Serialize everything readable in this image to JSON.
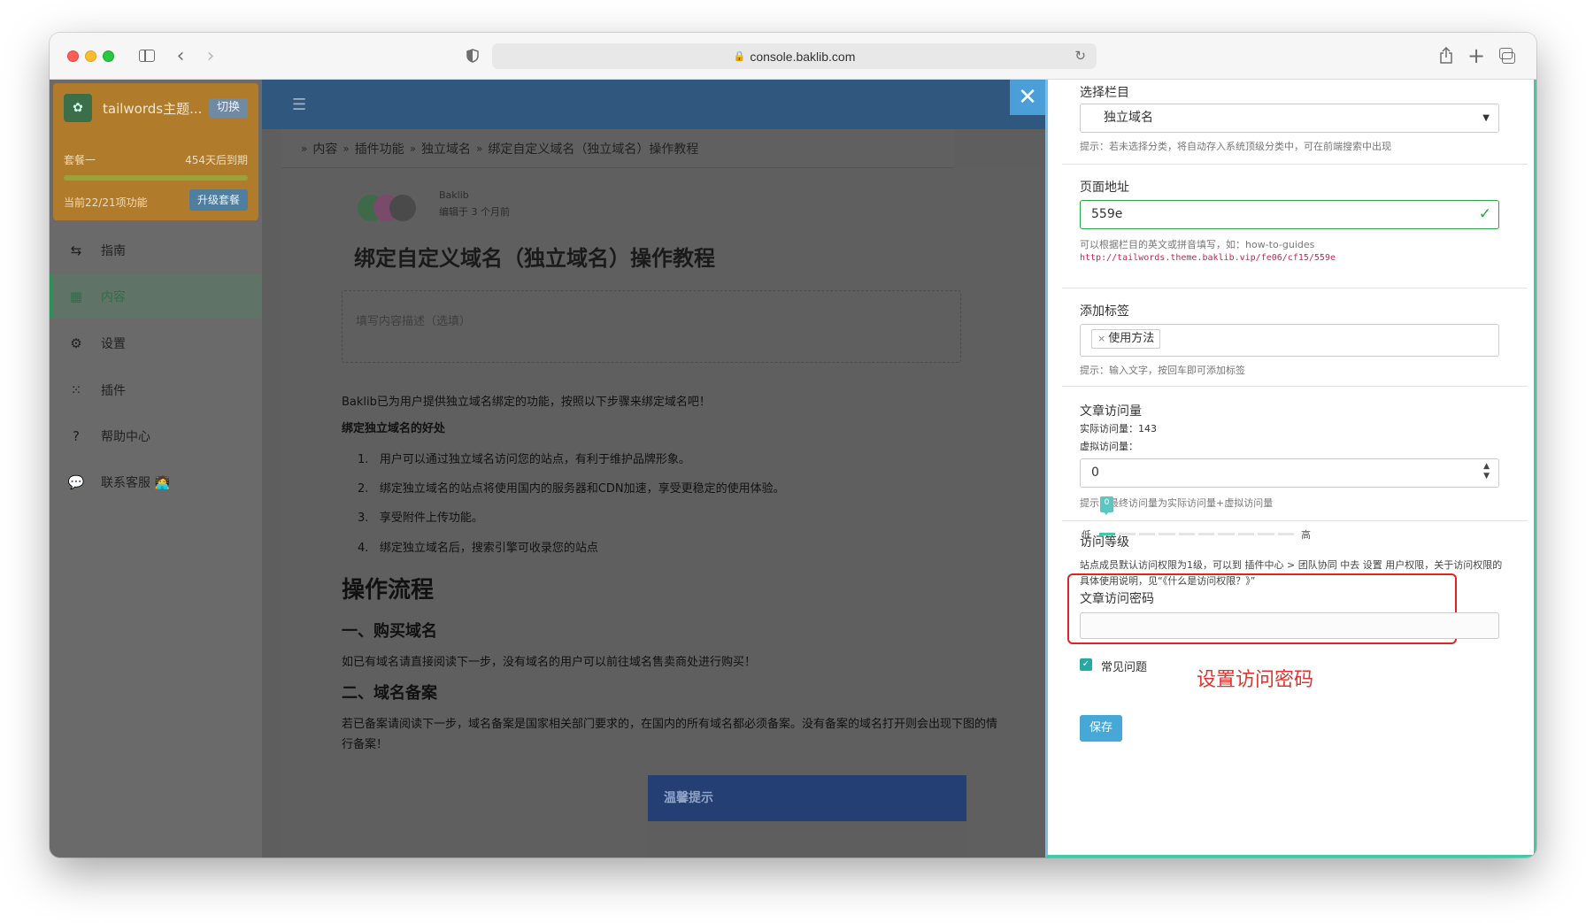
{
  "browser": {
    "url": "console.baklib.com"
  },
  "sidebar": {
    "site_name": "tailwords主题...",
    "switch_label": "切换",
    "plan_name": "套餐一",
    "plan_expire": "454天后到期",
    "plan_features": "当前22/21项功能",
    "upgrade_label": "升级套餐",
    "items": [
      {
        "label": "指南",
        "icon": "signpost-icon"
      },
      {
        "label": "内容",
        "icon": "grid-icon"
      },
      {
        "label": "设置",
        "icon": "gear-icon"
      },
      {
        "label": "插件",
        "icon": "apps-icon"
      },
      {
        "label": "帮助中心",
        "icon": "help-icon"
      },
      {
        "label": "联系客服 🧑‍💻",
        "icon": "chat-icon"
      }
    ]
  },
  "breadcrumb": [
    "内容",
    "插件功能",
    "独立域名",
    "绑定自定义域名（独立域名）操作教程"
  ],
  "article": {
    "author": "Baklib",
    "edited": "编辑于 3 个月前",
    "title": "绑定自定义域名（独立域名）操作教程",
    "desc_placeholder": "填写内容描述（选填）",
    "intro": "Baklib已为用户提供独立域名绑定的功能，按照以下步骤来绑定域名吧！",
    "benefits_heading": "绑定独立域名的好处",
    "benefits": [
      "用户可以通过独立域名访问您的站点，有利于维护品牌形象。",
      "绑定独立域名的站点将使用国内的服务器和CDN加速，享受更稳定的使用体验。",
      "享受附件上传功能。",
      "绑定独立域名后，搜索引擎可收录您的站点"
    ],
    "flow_heading": "操作流程",
    "step1_heading": "一、购买域名",
    "step1_text": "如已有域名请直接阅读下一步，没有域名的用户可以前往域名售卖商处进行购买！",
    "step2_heading": "二、域名备案",
    "step2_text_1": "若已备案请阅读下一步，域名备案是国家相关部门要求的，在国内的所有域名都必须备案。没有备案的域名打开则会出现下图的情",
    "step2_text_2": "行备案！",
    "tip_title": "温馨提示"
  },
  "drawer": {
    "category_label": "选择栏目",
    "category_value": "独立域名",
    "category_hint": "提示：若未选择分类，将自动存入系统顶级分类中，可在前端搜索中出现",
    "path_label": "页面地址",
    "path_value": "559e",
    "path_hint": "可以根据栏目的英文或拼音填写，如：how-to-guides",
    "path_url": "http://tailwords.theme.baklib.vip/fe06/cf15/559e",
    "tags_label": "添加标签",
    "tags": [
      "使用方法"
    ],
    "tags_hint": "提示：输入文字，按回车即可添加标签",
    "views_label": "文章访问量",
    "views_actual": "实际访问量：143",
    "views_virtual_label": "虚拟访问量：",
    "views_virtual_value": "0",
    "views_hint": "提示：最终访问量为实际访问量+虚拟访问量",
    "level_label": "访问等级",
    "level_value": "0",
    "level_low": "低",
    "level_high": "高",
    "level_hint_1": "站点成员默认访问权限为1级，可以到 插件中心 > 团队协同 中去 设置 用户权限，关于访问权限的",
    "level_hint_2": "具体使用说明，见“《什么是访问权限？》”",
    "password_label": "文章访问密码",
    "password_value": "",
    "faq_label": "常见问题",
    "annotation": "设置访问密码",
    "save_label": "保存"
  }
}
